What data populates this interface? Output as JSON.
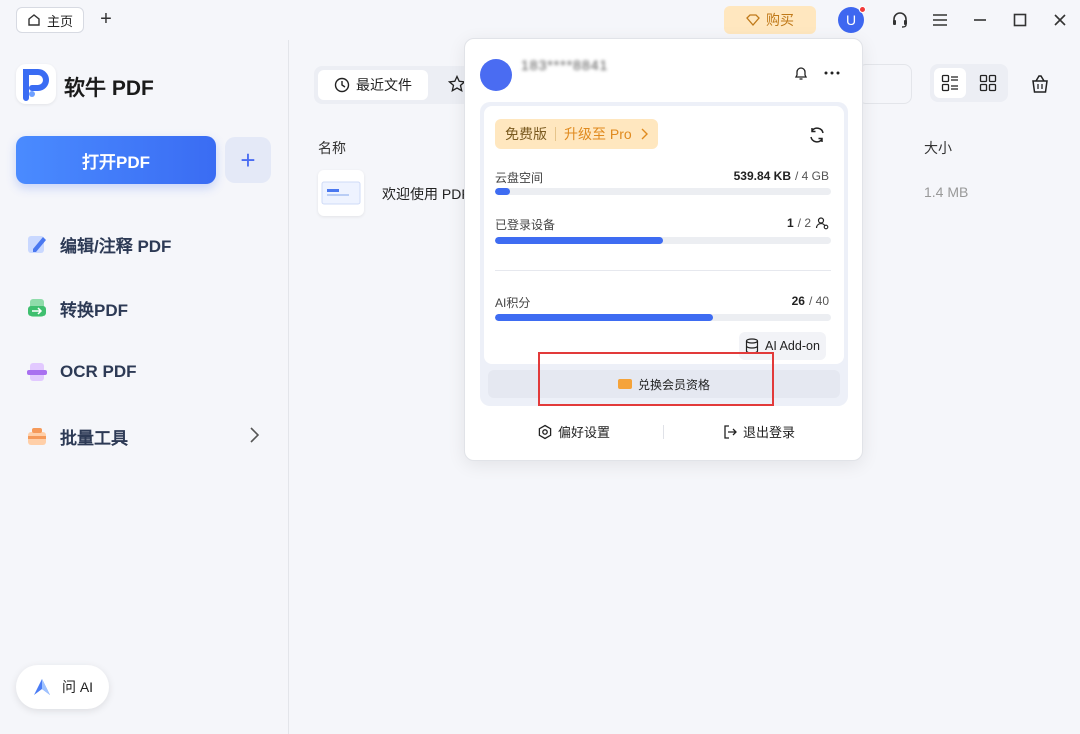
{
  "titlebar": {
    "home_tab_label": "主页",
    "buy_label": "购买",
    "avatar_letter": "U"
  },
  "sidebar": {
    "app_name": "软牛 PDF",
    "open_button": "打开PDF",
    "nav": [
      {
        "label": "编辑/注释 PDF",
        "icon": "edit-annotate-icon"
      },
      {
        "label": "转换PDF",
        "icon": "convert-icon"
      },
      {
        "label": "OCR PDF",
        "icon": "ocr-icon"
      },
      {
        "label": "批量工具",
        "icon": "batch-tools-icon"
      }
    ],
    "ai_button": "问 AI"
  },
  "main": {
    "tab_recent": "最近文件",
    "columns": {
      "name": "名称",
      "size": "大小"
    },
    "files": [
      {
        "name": "欢迎使用 PDF",
        "size": "1.4 MB"
      }
    ]
  },
  "popup": {
    "username": "183****8841",
    "plan_free": "免费版",
    "plan_upgrade": "升级至 Pro",
    "cloud_label": "云盘空间",
    "cloud_used": "539.84 KB",
    "cloud_total": "/ 4 GB",
    "cloud_progress": 0.0001,
    "devices_label": "已登录设备",
    "devices_used": "1",
    "devices_total": "/ 2",
    "devices_progress": 0.5,
    "ai_label": "AI积分",
    "ai_used": "26",
    "ai_total": "/ 40",
    "ai_progress": 0.65,
    "addon_label": "AI Add-on",
    "redeem_label": "兑换会员资格",
    "pref_label": "偏好设置",
    "logout_label": "退出登录"
  },
  "colors": {
    "accent": "#3e6cf2",
    "buy_bg": "#ffe7bf",
    "highlight_border": "#e23a3a"
  }
}
